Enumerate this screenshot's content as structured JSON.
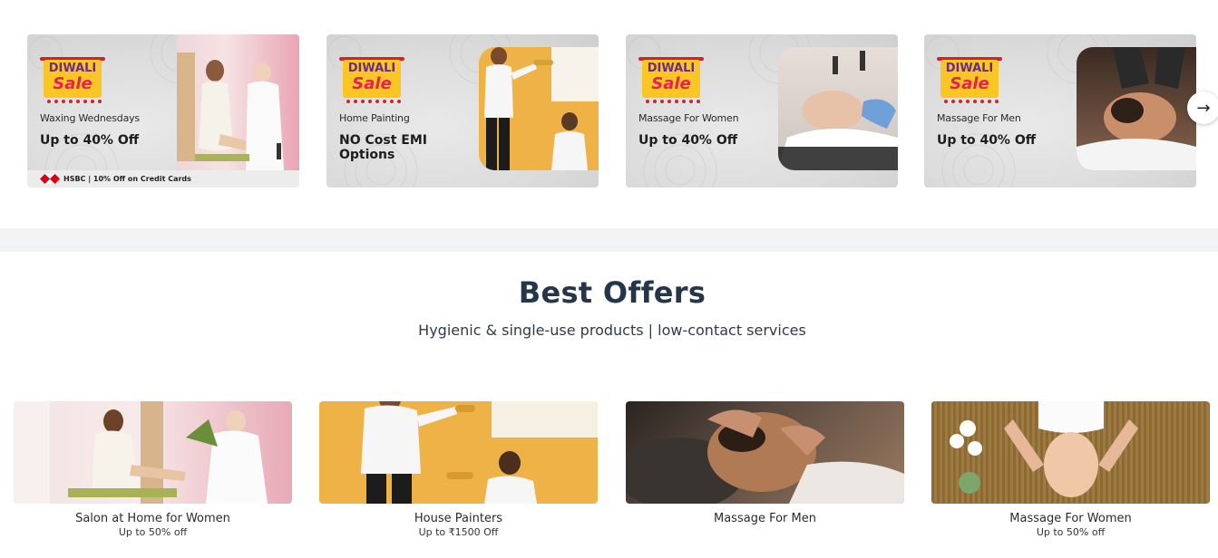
{
  "banners": [
    {
      "badge_top": "DIWALI",
      "badge_bottom": "Sale",
      "category": "Waxing Wednesdays",
      "offer": "Up to 40% Off",
      "bank_offer": "HSBC | 10% Off on Credit Cards"
    },
    {
      "badge_top": "DIWALI",
      "badge_bottom": "Sale",
      "category": "Home Painting",
      "offer": "NO Cost EMI Options"
    },
    {
      "badge_top": "DIWALI",
      "badge_bottom": "Sale",
      "category": "Massage For Women",
      "offer": "Up to 40% Off"
    },
    {
      "badge_top": "DIWALI",
      "badge_bottom": "Sale",
      "category": "Massage For Men",
      "offer": "Up to 40% Off"
    }
  ],
  "carousel": {
    "next_icon": "arrow-right-icon",
    "next_glyph": "→"
  },
  "section": {
    "title": "Best Offers",
    "subtitle": "Hygienic & single-use products | low-contact services"
  },
  "offers": [
    {
      "name": "Salon at Home for Women",
      "discount": "Up to 50% off"
    },
    {
      "name": "House Painters",
      "discount": "Up to ₹1500 Off"
    },
    {
      "name": "Massage For Men",
      "discount": ""
    },
    {
      "name": "Massage For Women",
      "discount": "Up to 50% off"
    }
  ],
  "colors": {
    "badge_yellow": "#f9c623",
    "badge_red": "#e8205a",
    "badge_purple": "#6d2a8a",
    "heading": "#25364a",
    "paint_orange": "#efb246"
  }
}
